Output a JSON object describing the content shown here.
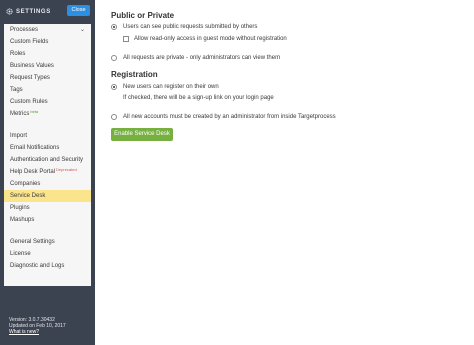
{
  "header": {
    "title": "SETTINGS",
    "icon": "gear-icon",
    "close_label": "Close",
    "accent": "#2d8fe0"
  },
  "sidebar": {
    "items": [
      {
        "label": "Processes",
        "has_chevron": true,
        "chevron": "⌄"
      },
      {
        "label": "Custom Fields"
      },
      {
        "label": "Roles"
      },
      {
        "label": "Business Values"
      },
      {
        "label": "Request Types"
      },
      {
        "label": "Tags"
      },
      {
        "label": "Custom Rules"
      },
      {
        "label": "Metrics",
        "badge": "beta"
      },
      {
        "label": "Import"
      },
      {
        "label": "Email Notifications"
      },
      {
        "label": "Authentication and Security"
      },
      {
        "label": "Help Desk Portal",
        "badge": "Deprecated"
      },
      {
        "label": "Companies"
      },
      {
        "label": "Service Desk",
        "active": true
      },
      {
        "label": "Plugins"
      },
      {
        "label": "Mashups"
      },
      {
        "label": "General Settings"
      },
      {
        "label": "License"
      },
      {
        "label": "Diagnostic and Logs"
      }
    ],
    "active_color": "#fbe58c"
  },
  "footer": {
    "version": "Version: 3.0.7.30432",
    "updated": "Updated on Feb 10, 2017",
    "whats_new": "What is new?"
  },
  "main": {
    "public_private": {
      "title": "Public or Private",
      "option_public": "Users can see public requests submitted by others",
      "option_public_checked": true,
      "guest_checkbox": "Allow read-only access in guest mode without registration",
      "guest_checked": false,
      "option_private": "All requests are private - only administrators can view them",
      "option_private_checked": false
    },
    "registration": {
      "title": "Registration",
      "option_own": "New users can register on their own",
      "option_own_checked": true,
      "hint": "If checked, there will be a sign-up link on your login page",
      "option_admin": "All new accounts must be created by an administrator from inside Targetprocess",
      "option_admin_checked": false
    },
    "enable_button": "Enable Service Desk",
    "button_color": "#77b040"
  }
}
